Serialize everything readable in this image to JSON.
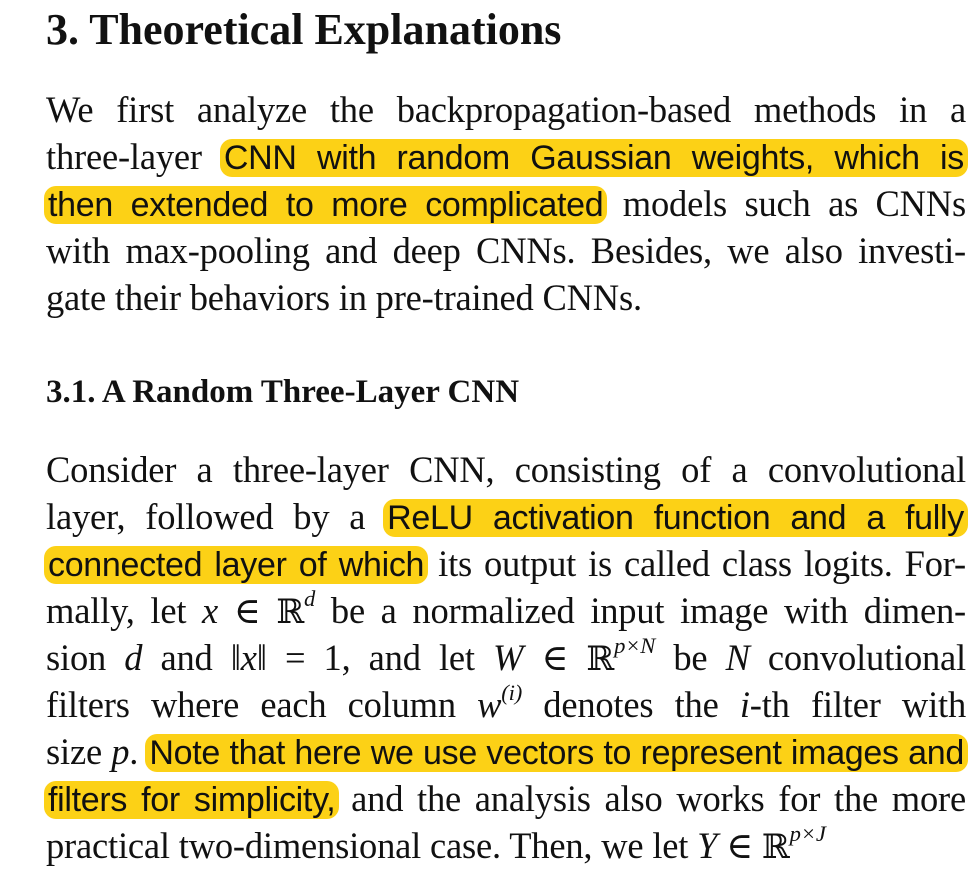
{
  "section": {
    "title": "3. Theoretical Explanations",
    "para1": {
      "l1": "We first analyze the backpropagation-based methods in a",
      "l2a": "three-layer ",
      "l2h": "CNN with random Gaussian weights, which is",
      "l3h": "then extended to more complicated",
      "l3b": " models such as CNNs",
      "l4": "with max-pooling and deep CNNs. Besides, we also investi-",
      "l5": "gate their behaviors in pre-trained CNNs."
    }
  },
  "subsection": {
    "title": "3.1. A Random Three-Layer CNN",
    "para2": {
      "l1": "Consider a three-layer CNN, consisting of a convolutional",
      "l2a": "layer, followed by a ",
      "l2h": "ReLU activation function and a fully",
      "l3h": "connected layer of which",
      "l3b": " its output is called class logits. For-",
      "l4a": "mally, let ",
      "l4x": "x",
      "l4in": " ∈ ",
      "l4R": "ℝ",
      "l4d": "d",
      "l4b": " be a normalized input image with dimen-",
      "l5a": "sion ",
      "l5d": "d",
      "l5b": " and ",
      "l5norm": "‖x‖",
      "l5c": " = 1, and let ",
      "l5W": "W",
      "l5in": " ∈ ",
      "l5R": "ℝ",
      "l5sup": "p×N",
      "l5e": " be ",
      "l5N": "N",
      "l5f": " convolutional",
      "l6a": "filters where each column ",
      "l6w": "w",
      "l6sup": "(i)",
      "l6b": " denotes the ",
      "l6i": "i",
      "l6c": "-th filter with",
      "l7a": "size ",
      "l7p": "p",
      "l7b": ". ",
      "l7h": "Note that here we use vectors to represent images and",
      "l8h": "filters for simplicity,",
      "l8b": " and the analysis also works for the more",
      "l9a": "practical two-dimensional case.  Then, we let ",
      "l9Y": "Y",
      "l9in": " ∈ ",
      "l9R": "ℝ",
      "l9sup": "p×J"
    }
  },
  "colors": {
    "highlight": "#fcd116",
    "text": "#111111",
    "background": "#ffffff"
  }
}
